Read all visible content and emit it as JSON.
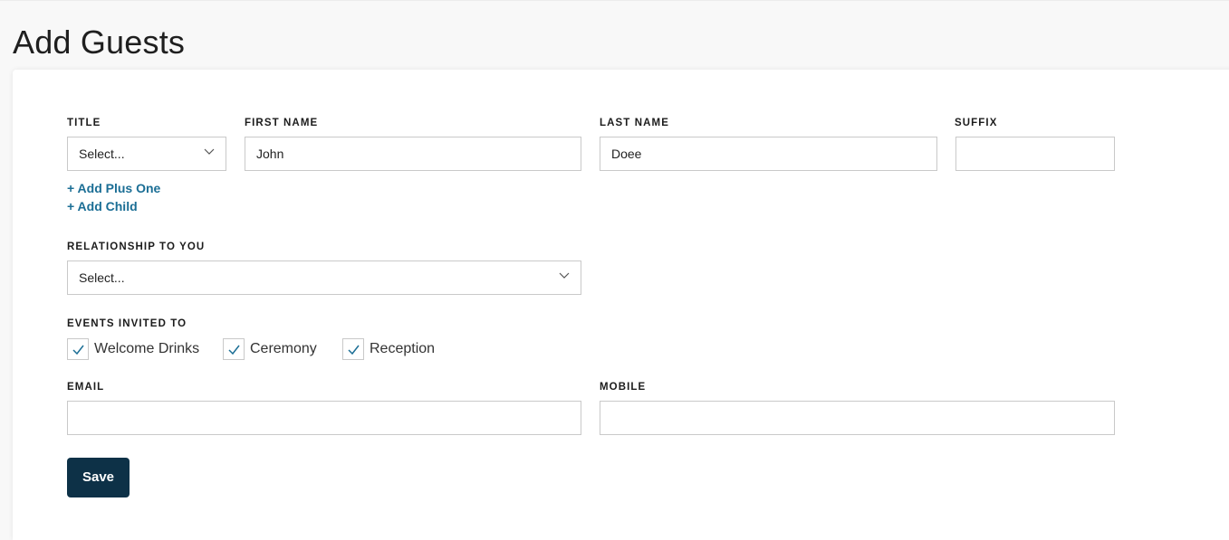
{
  "page": {
    "title": "Add Guests"
  },
  "form": {
    "title": {
      "label": "TITLE",
      "value": "Select..."
    },
    "first_name": {
      "label": "FIRST NAME",
      "value": "John"
    },
    "last_name": {
      "label": "LAST NAME",
      "value": "Doee"
    },
    "suffix": {
      "label": "SUFFIX",
      "value": ""
    },
    "links": {
      "add_plus_one": "+ Add Plus One",
      "add_child": "+ Add Child"
    },
    "relationship": {
      "label": "RELATIONSHIP TO YOU",
      "value": "Select..."
    },
    "events": {
      "label": "EVENTS INVITED TO",
      "items": [
        {
          "label": "Welcome Drinks",
          "checked": true
        },
        {
          "label": "Ceremony",
          "checked": true
        },
        {
          "label": "Reception",
          "checked": true
        }
      ]
    },
    "email": {
      "label": "EMAIL",
      "value": ""
    },
    "mobile": {
      "label": "MOBILE",
      "value": ""
    },
    "save_label": "Save"
  },
  "colors": {
    "link": "#1b6e95",
    "button": "#0d3147",
    "check": "#1b6e95"
  }
}
